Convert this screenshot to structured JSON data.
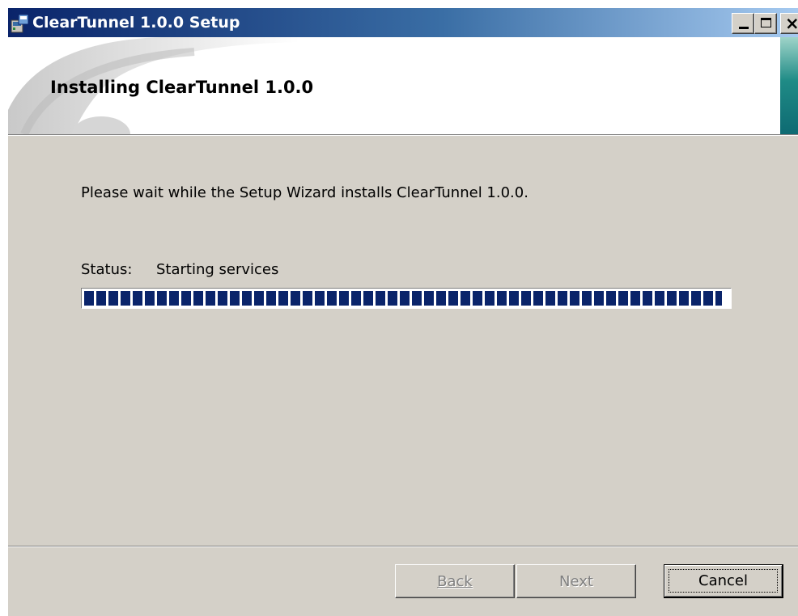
{
  "window": {
    "title": "ClearTunnel 1.0.0 Setup",
    "controls": {
      "minimize": "minimize",
      "maximize": "maximize",
      "close": "close"
    }
  },
  "banner": {
    "title": "Installing ClearTunnel 1.0.0"
  },
  "main": {
    "description": "Please wait while the Setup Wizard installs ClearTunnel 1.0.0.",
    "status_label": "Status:",
    "status_value": "Starting services",
    "progress_fraction": 0.99
  },
  "buttons": {
    "back": "Back",
    "next": "Next",
    "cancel": "Cancel"
  },
  "colors": {
    "titlebar_start": "#0a246a",
    "titlebar_end": "#a6caf0",
    "progress_fill": "#0a246a",
    "face": "#d4d0c8"
  },
  "icons": [
    "installer-icon",
    "minimize-icon",
    "maximize-icon",
    "close-icon"
  ]
}
